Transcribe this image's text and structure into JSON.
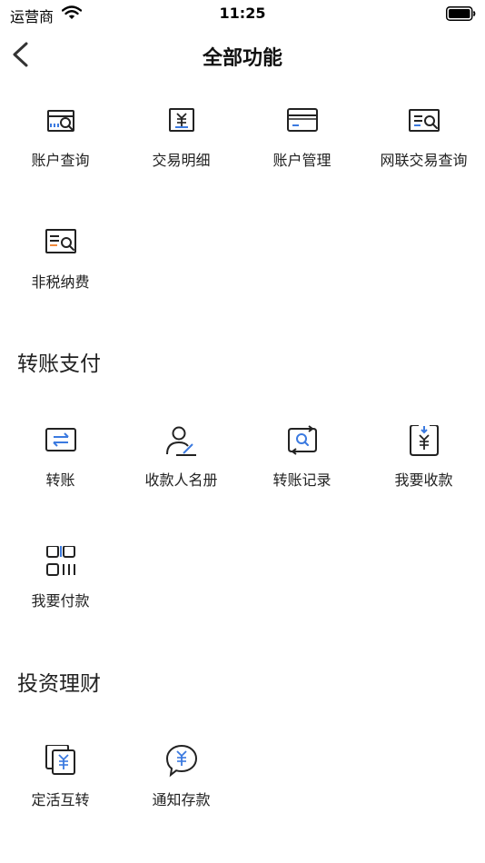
{
  "status_bar": {
    "carrier": "运营商",
    "time": "11:25"
  },
  "nav": {
    "title": "全部功能"
  },
  "sections": [
    {
      "title": "",
      "items": [
        {
          "label": "账户查询",
          "icon": "account-query-icon"
        },
        {
          "label": "交易明细",
          "icon": "transaction-detail-icon"
        },
        {
          "label": "账户管理",
          "icon": "account-management-icon"
        },
        {
          "label": "网联交易查询",
          "icon": "netunion-query-icon"
        },
        {
          "label": "非税纳费",
          "icon": "non-tax-payment-icon"
        }
      ]
    },
    {
      "title": "转账支付",
      "items": [
        {
          "label": "转账",
          "icon": "transfer-icon"
        },
        {
          "label": "收款人名册",
          "icon": "payee-list-icon"
        },
        {
          "label": "转账记录",
          "icon": "transfer-records-icon"
        },
        {
          "label": "我要收款",
          "icon": "receive-money-icon"
        },
        {
          "label": "我要付款",
          "icon": "pay-money-icon"
        }
      ]
    },
    {
      "title": "投资理财",
      "items": [
        {
          "label": "定活互转",
          "icon": "fixed-current-transfer-icon"
        },
        {
          "label": "通知存款",
          "icon": "notice-deposit-icon"
        }
      ]
    }
  ],
  "colors": {
    "accent": "#3b7ae0",
    "orange": "#f08a3c",
    "icon_stroke": "#222222"
  }
}
